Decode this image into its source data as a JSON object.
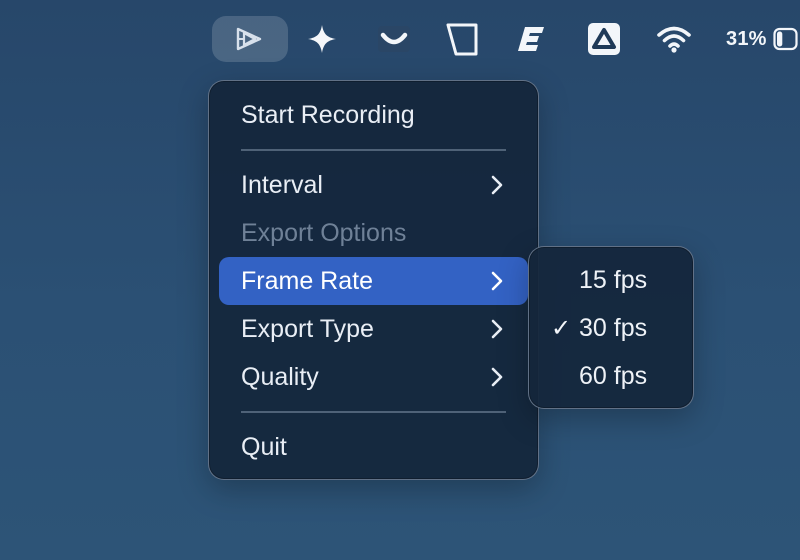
{
  "menubar": {
    "icons": [
      {
        "name": "recorder-app-icon",
        "active": true
      },
      {
        "name": "sparkle-icon"
      },
      {
        "name": "smile-arc-icon"
      },
      {
        "name": "crop-shape-icon"
      },
      {
        "name": "e-logo-icon"
      },
      {
        "name": "drive-triangle-icon"
      },
      {
        "name": "wifi-icon"
      }
    ],
    "battery": {
      "percent_label": "31%",
      "level": 0.31
    }
  },
  "menu": {
    "start_recording": "Start Recording",
    "interval": "Interval",
    "export_options": "Export Options",
    "frame_rate": "Frame Rate",
    "export_type": "Export Type",
    "quality": "Quality",
    "quit": "Quit"
  },
  "submenu": {
    "items": [
      {
        "label": "15 fps",
        "checked": false
      },
      {
        "label": "30 fps",
        "checked": true
      },
      {
        "label": "60 fps",
        "checked": false
      }
    ],
    "check_glyph": "✓"
  },
  "colors": {
    "highlight": "#3362c4",
    "menu_bg": "#14263c",
    "disabled_text": "#6f8197"
  }
}
